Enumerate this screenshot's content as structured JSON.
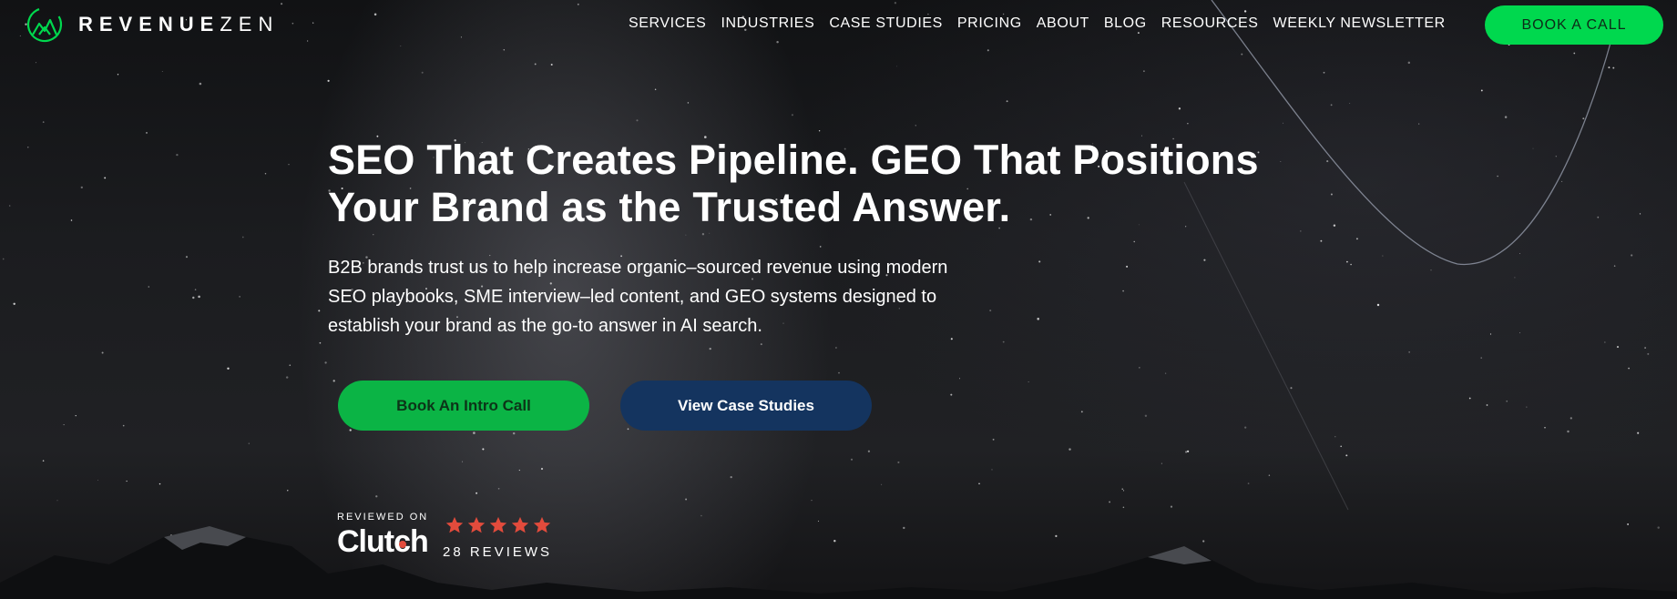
{
  "brand": {
    "name_bold": "REVENUE",
    "name_light": "ZEN",
    "accent_color": "#00d84e",
    "logo_icon": "mountain-circle-icon"
  },
  "nav": {
    "items": [
      {
        "label": "SERVICES"
      },
      {
        "label": "INDUSTRIES"
      },
      {
        "label": "CASE STUDIES"
      },
      {
        "label": "PRICING"
      },
      {
        "label": "ABOUT"
      },
      {
        "label": "BLOG"
      },
      {
        "label": "RESOURCES"
      },
      {
        "label": "WEEKLY NEWSLETTER"
      }
    ],
    "cta_label": "BOOK A CALL"
  },
  "hero": {
    "headline": "SEO That Creates Pipeline. GEO That Positions Your Brand as the Trusted Answer.",
    "subtext": "B2B brands trust us to help increase organic–sourced revenue using modern SEO playbooks, SME interview–led content, and GEO systems designed to establish your brand as the go-to answer in AI search.",
    "primary_button": "Book An Intro Call",
    "secondary_button": "View Case Studies",
    "primary_color": "#0bb445",
    "secondary_color": "#14345f"
  },
  "clutch": {
    "reviewed_on": "REVIEWED ON",
    "logo_text": "Clutch",
    "rating_stars": 5,
    "reviews_count": "28 REVIEWS",
    "star_color": "#e24b3c"
  }
}
